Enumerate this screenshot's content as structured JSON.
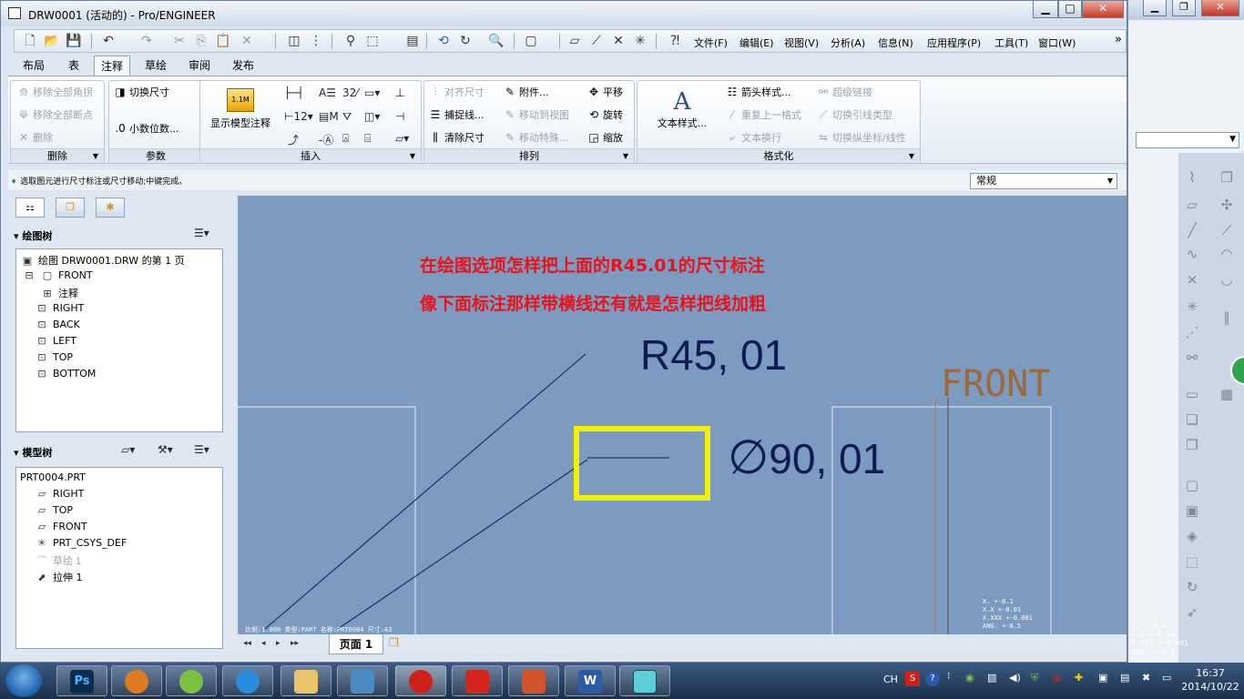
{
  "window": {
    "title": "DRW0001 (活动的) - Pro/ENGINEER",
    "min_glyph": "▁",
    "max_glyph": "□",
    "close_glyph": "✕"
  },
  "bg_window": {
    "min_glyph": "▁",
    "max_glyph": "❐",
    "close_glyph": "✕",
    "table_lines": [
      "X.  +-0.1",
      "X.X  +-0.01",
      "X.XXX +-0.001",
      "ANG. +-0.5"
    ]
  },
  "menus": [
    "文件(F)",
    "编辑(E)",
    "视图(V)",
    "分析(A)",
    "信息(N)",
    "应用程序(P)",
    "工具(T)",
    "窗口(W)"
  ],
  "menu_more": "»",
  "tabs": [
    "布局",
    "表",
    "注释",
    "草绘",
    "审阅",
    "发布"
  ],
  "active_tab": "注释",
  "ribbon": {
    "delete_group": {
      "title": "删除",
      "items": [
        "移除全部角拐",
        "移除全部断点",
        "删除"
      ]
    },
    "params_group": {
      "title": "参数",
      "items": [
        "切换尺寸",
        "小数位数..."
      ]
    },
    "insert_group": {
      "title": "插入",
      "big_button": "显示模型注释"
    },
    "arrange_group": {
      "title": "排列",
      "col1": [
        "对齐尺寸",
        "捕捉线...",
        "清除尺寸"
      ],
      "col2": [
        "附件...",
        "移动到视图",
        "移动特殊..."
      ],
      "col3": [
        "平移",
        "旋转",
        "缩放"
      ]
    },
    "format_group": {
      "title": "格式化",
      "big_button": "文本样式...",
      "col1": [
        "箭头样式...",
        "重复上一格式",
        "文本换行"
      ],
      "col2": [
        "超级链接",
        "切换引线类型",
        "切换纵坐标/线性"
      ]
    }
  },
  "status": {
    "message": "选取图元进行尺寸标注或尺寸移动;中键完成。",
    "filter": "常规"
  },
  "drawing_tree": {
    "title": "绘图树",
    "root": "绘图 DRW0001.DRW 的第 1 页",
    "items": [
      "FRONT",
      "注释",
      "RIGHT",
      "BACK",
      "LEFT",
      "TOP",
      "BOTTOM"
    ]
  },
  "model_tree": {
    "title": "模型树",
    "root": "PRT0004.PRT",
    "items": [
      "RIGHT",
      "TOP",
      "FRONT",
      "PRT_CSYS_DEF",
      "草绘 1",
      "拉伸 1"
    ]
  },
  "canvas": {
    "note_line1": "在绘图选项怎样把上面的R45.01的尺寸标注",
    "note_line2": "像下面标注那样带横线还有就是怎样把线加粗",
    "dim1": "R45, 01",
    "dim2_symbol": "∅",
    "dim2_value": "90, 01",
    "view_label": "FRONT",
    "bottom_info": "比例:1.000  类型:PART  名称:PRT0004  尺寸:A3",
    "table_lines": [
      "X.  +-0.1",
      "X.X  +-0.01",
      "X.XXX +-0.001",
      "ANG. +-0.5"
    ],
    "highlight_color": "#f2f200"
  },
  "pagebar": {
    "page_tab": "页面  1"
  },
  "taskbar": {
    "apps": [
      "Ps",
      "",
      "",
      "",
      "",
      "",
      "",
      "",
      "",
      "W",
      ""
    ],
    "lang": "CH",
    "time": "16:37",
    "date": "2014/10/22"
  }
}
